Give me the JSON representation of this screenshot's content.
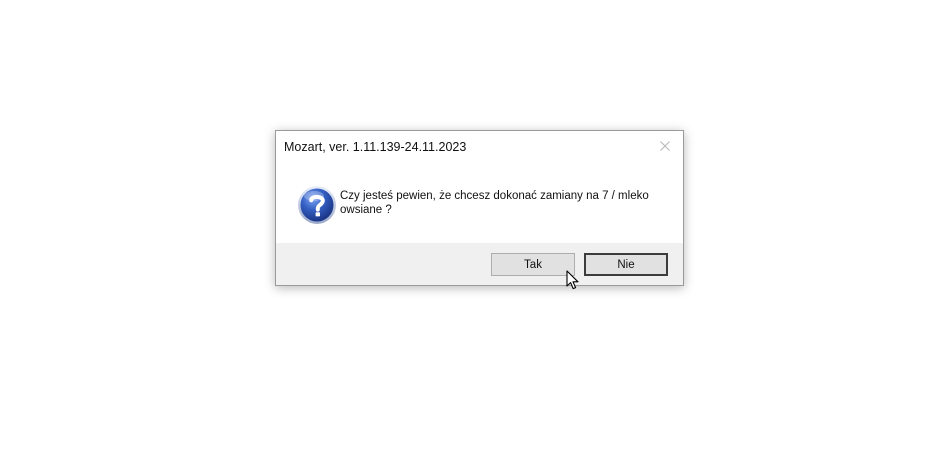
{
  "dialog": {
    "title": "Mozart, ver. 1.11.139-24.11.2023",
    "close_icon": "close-icon",
    "message": "Czy jesteś pewien, że chcesz dokonać zamiany na 7 / mleko owsiane ?",
    "message_icon": "question-icon",
    "buttons": {
      "yes_label": "Tak",
      "no_label": "Nie"
    }
  },
  "colors": {
    "footer_bg": "#f0f0f0",
    "icon_blue": "#2a4fb0",
    "button_bg": "#e1e1e1"
  }
}
